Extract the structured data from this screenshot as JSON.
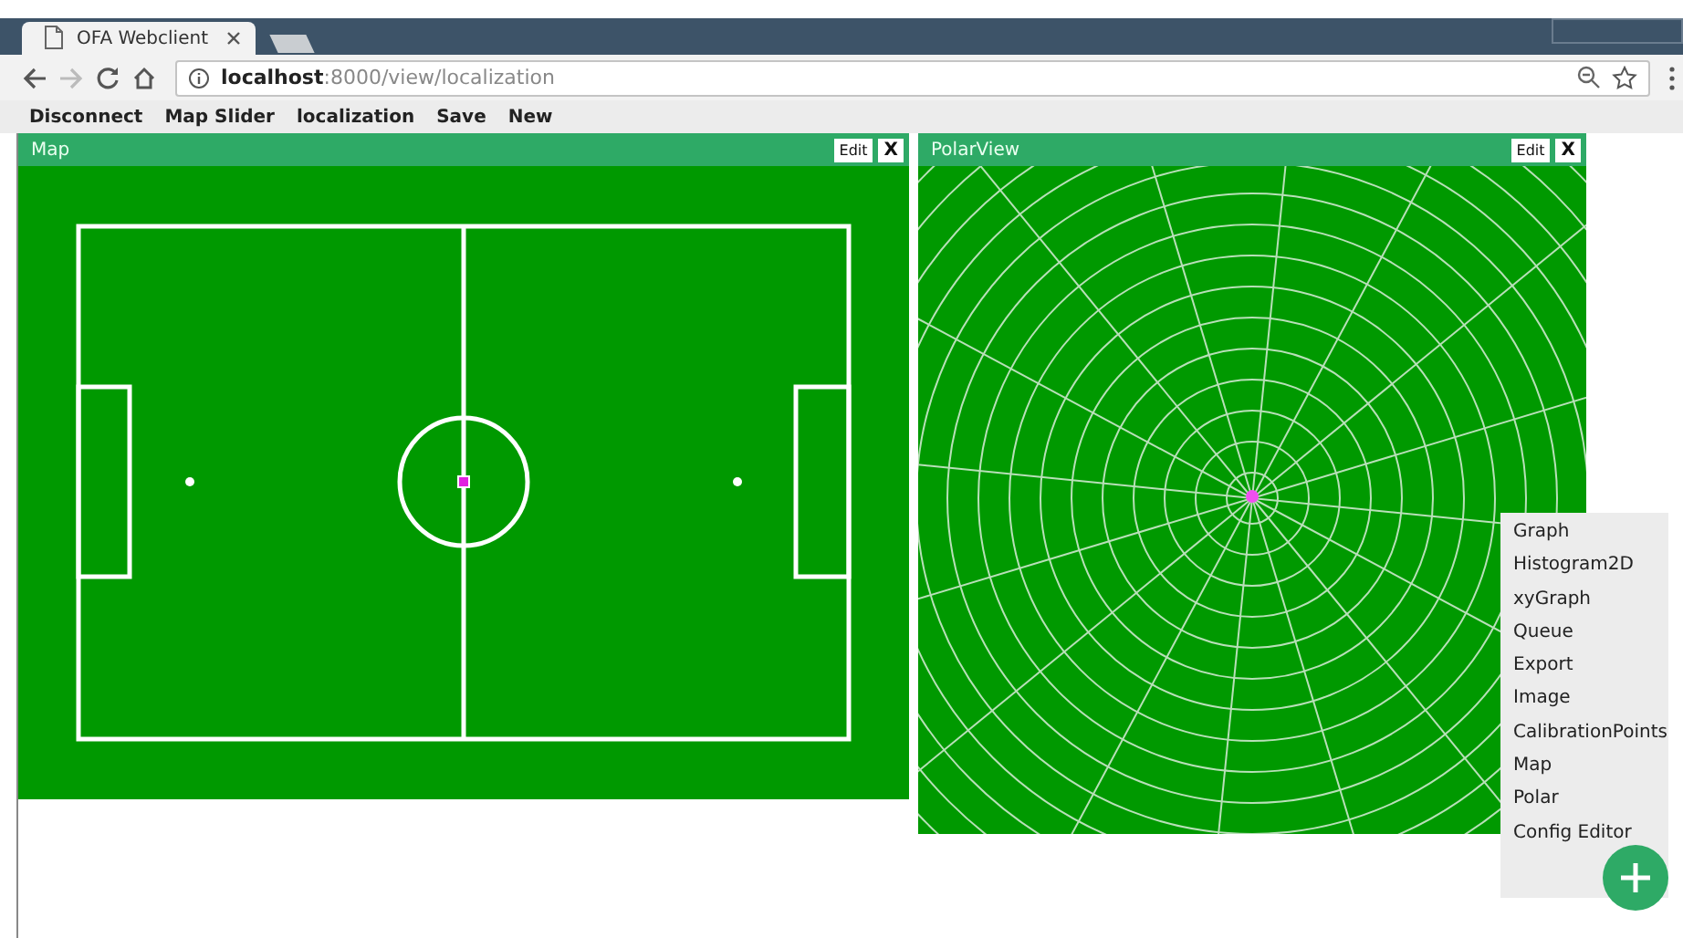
{
  "browser": {
    "tabs": [
      {
        "title": "OFA Webclient",
        "selected": true
      }
    ],
    "address": {
      "host": "localhost",
      "path": ":8000/view/localization"
    },
    "forward_disabled": true
  },
  "menu_bar": [
    "Disconnect",
    "Map Slider",
    "localization",
    "Save",
    "New"
  ],
  "panels": [
    {
      "title": "Map",
      "kind": "map",
      "edit": "Edit",
      "close": "X"
    },
    {
      "title": "PolarView",
      "kind": "polar",
      "edit": "Edit",
      "close": "X"
    }
  ],
  "add_menu": {
    "items": [
      "Graph",
      "Histogram2D",
      "xyGraph",
      "Queue",
      "Export",
      "Image",
      "CalibrationPoints",
      "Map",
      "Polar",
      "Config Editor"
    ]
  }
}
